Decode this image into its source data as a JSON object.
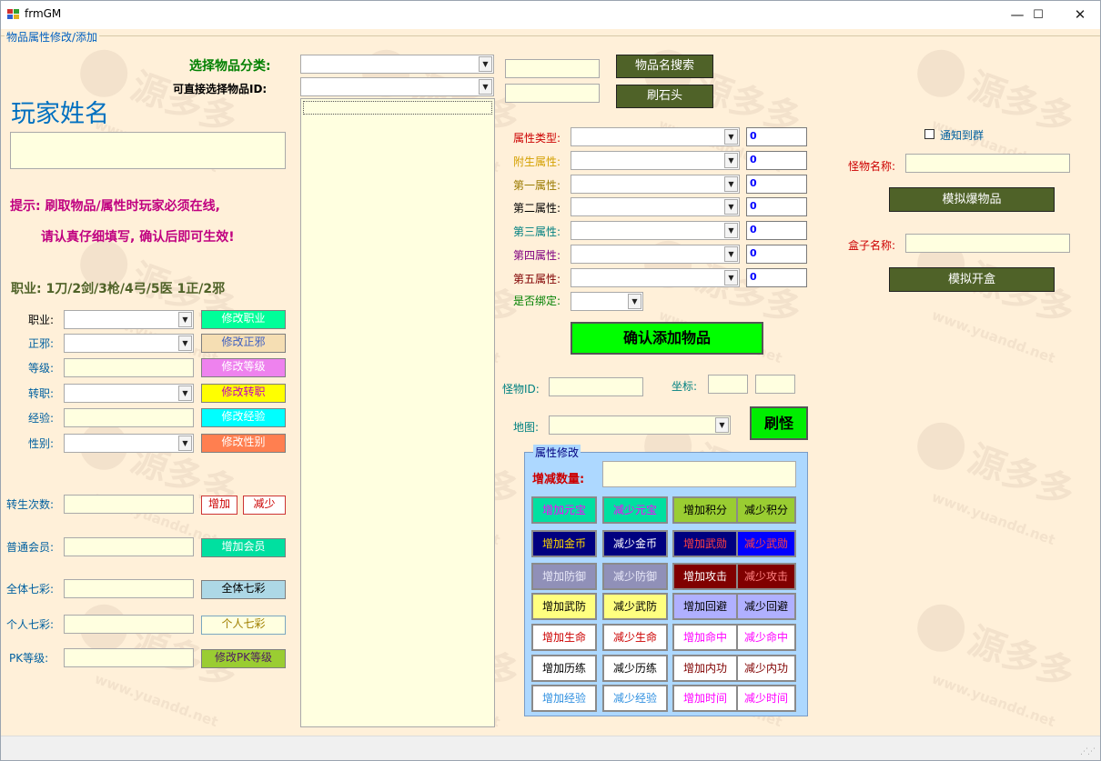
{
  "window": {
    "title": "frmGM",
    "minimize": "—",
    "maximize": "☐",
    "close": "✕"
  },
  "group": {
    "title": "物品属性修改/添加"
  },
  "top": {
    "category_label": "选择物品分类:",
    "direct_label": "可直接选择物品ID:",
    "search_button": "物品名搜索",
    "stone_button": "刷石头"
  },
  "left": {
    "player_name_label": "玩家姓名",
    "tip_line1": "提示: 刷取物品/属性时玩家必须在线,",
    "tip_line2": "请认真仔细填写, 确认后即可生效!",
    "job_hint": "职业: 1刀/2剑/3枪/4弓/5医    1正/2邪",
    "rows": [
      {
        "label": "职业:",
        "button": "修改职业"
      },
      {
        "label": "正邪:",
        "button": "修改正邪"
      },
      {
        "label": "等级:",
        "button": "修改等级"
      },
      {
        "label": "转职:",
        "button": "修改转职"
      },
      {
        "label": "经验:",
        "button": "修改经验"
      },
      {
        "label": "性别:",
        "button": "修改性别"
      }
    ],
    "rebirth_label": "转生次数:",
    "rebirth_add": "增加",
    "rebirth_sub": "减少",
    "member_label": "普通会员:",
    "member_button": "增加会员",
    "all_color_label": "全体七彩:",
    "all_color_button": "全体七彩",
    "self_color_label": "个人七彩:",
    "self_color_button": "个人七彩",
    "pk_label": "PK等级:",
    "pk_button": "修改PK等级"
  },
  "attrs": {
    "rows": [
      {
        "label": "属性类型:",
        "value": "0",
        "color": "#cc0000"
      },
      {
        "label": "附生属性:",
        "value": "0",
        "color": "#d4a000"
      },
      {
        "label": "第一属性:",
        "value": "0",
        "color": "#9a7a00"
      },
      {
        "label": "第二属性:",
        "value": "0",
        "color": "#000000"
      },
      {
        "label": "第三属性:",
        "value": "0",
        "color": "#008080"
      },
      {
        "label": "第四属性:",
        "value": "0",
        "color": "#800080"
      },
      {
        "label": "第五属性:",
        "value": "0",
        "color": "#800000"
      }
    ],
    "bind_label": "是否绑定:",
    "confirm_button": "确认添加物品"
  },
  "monster": {
    "id_label": "怪物ID:",
    "coord_label": "坐标:",
    "map_label": "地图:",
    "spawn_button": "刷怪"
  },
  "prop": {
    "title": "属性修改",
    "amount_label": "增减数量:",
    "buttons": [
      {
        "label": "增加元宝",
        "bg": "#00e0a0",
        "fg": "#ff00ff"
      },
      {
        "label": "减少元宝",
        "bg": "#00e0a0",
        "fg": "#ff00ff"
      },
      {
        "label": "增加积分",
        "bg": "#9acd32",
        "fg": "#000000"
      },
      {
        "label": "减少积分",
        "bg": "#9acd32",
        "fg": "#000000"
      },
      {
        "label": "增加金币",
        "bg": "#000080",
        "fg": "#ffd700"
      },
      {
        "label": "减少金币",
        "bg": "#000080",
        "fg": "#ffffff"
      },
      {
        "label": "增加武勋",
        "bg": "#000080",
        "fg": "#ff4040"
      },
      {
        "label": "减少武勋",
        "bg": "#0000ff",
        "fg": "#ff4040"
      },
      {
        "label": "增加防御",
        "bg": "#9090b8",
        "fg": "#e8e8f8"
      },
      {
        "label": "减少防御",
        "bg": "#9090b8",
        "fg": "#e8e8f8"
      },
      {
        "label": "增加攻击",
        "bg": "#800000",
        "fg": "#ffffff"
      },
      {
        "label": "减少攻击",
        "bg": "#800000",
        "fg": "#ff8080"
      },
      {
        "label": "增加武防",
        "bg": "#ffff80",
        "fg": "#000000"
      },
      {
        "label": "减少武防",
        "bg": "#ffff80",
        "fg": "#000000"
      },
      {
        "label": "增加回避",
        "bg": "#b0b0ff",
        "fg": "#000000"
      },
      {
        "label": "减少回避",
        "bg": "#b0b0ff",
        "fg": "#000000"
      },
      {
        "label": "增加生命",
        "bg": "#ffffff",
        "fg": "#cc0000"
      },
      {
        "label": "减少生命",
        "bg": "#ffffff",
        "fg": "#cc0000"
      },
      {
        "label": "增加命中",
        "bg": "#ffffff",
        "fg": "#ff00ff"
      },
      {
        "label": "减少命中",
        "bg": "#ffffff",
        "fg": "#ff00ff"
      },
      {
        "label": "增加历练",
        "bg": "#ffffff",
        "fg": "#000000"
      },
      {
        "label": "减少历练",
        "bg": "#ffffff",
        "fg": "#000000"
      },
      {
        "label": "增加内功",
        "bg": "#ffffff",
        "fg": "#800000"
      },
      {
        "label": "减少内功",
        "bg": "#ffffff",
        "fg": "#800000"
      },
      {
        "label": "增加经验",
        "bg": "#ffffff",
        "fg": "#3090e0"
      },
      {
        "label": "减少经验",
        "bg": "#ffffff",
        "fg": "#3090e0"
      },
      {
        "label": "增加时间",
        "bg": "#ffffff",
        "fg": "#ff00ff"
      },
      {
        "label": "减少时间",
        "bg": "#ffffff",
        "fg": "#ff00ff"
      }
    ]
  },
  "right": {
    "notify_label": "通知到群",
    "monster_name_label": "怪物名称:",
    "sim_drop_button": "模拟爆物品",
    "box_name_label": "盒子名称:",
    "sim_open_button": "模拟开盒"
  },
  "watermark": {
    "text": "源多多",
    "url": "www.yuandd.net"
  }
}
